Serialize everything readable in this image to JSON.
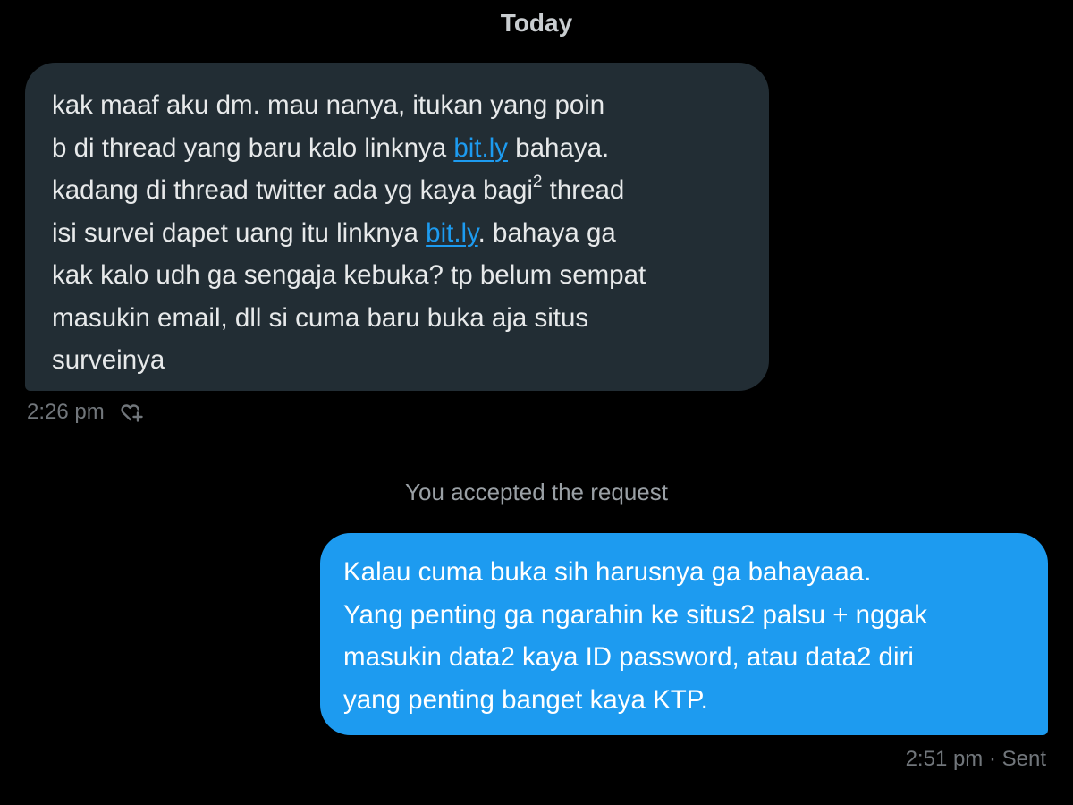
{
  "conversation": {
    "day_label": "Today",
    "incoming_message": {
      "lines": [
        [
          {
            "text": "kak maaf aku dm. mau nanya, itukan yang poin"
          }
        ],
        [
          {
            "text": "b di thread yang baru kalo linknya "
          },
          {
            "text": "bit.ly",
            "link": true
          },
          {
            "text": " bahaya."
          }
        ],
        [
          {
            "text": "kadang di thread twitter ada yg kaya bagi"
          },
          {
            "text": "2",
            "sup": true
          },
          {
            "text": " thread"
          }
        ],
        [
          {
            "text": "isi survei dapet uang itu linknya "
          },
          {
            "text": "bit.ly",
            "link": true
          },
          {
            "text": ". bahaya ga"
          }
        ],
        [
          {
            "text": "kak kalo udh ga sengaja kebuka? tp belum sempat"
          }
        ],
        [
          {
            "text": "masukin email, dll si cuma baru buka aja situs"
          }
        ],
        [
          {
            "text": "surveinya"
          }
        ]
      ],
      "timestamp": "2:26 pm",
      "react_icon": "heart-plus-icon"
    },
    "system_note": "You accepted the request",
    "outgoing_message": {
      "lines": [
        "Kalau cuma buka sih harusnya ga bahayaaa.",
        "Yang penting ga ngarahin ke situs2 palsu + nggak",
        "masukin data2 kaya ID password, atau data2 diri",
        "yang penting banget kaya KTP."
      ],
      "timestamp": "2:51 pm · Sent"
    }
  },
  "colors": {
    "background": "#000000",
    "incoming_bubble": "#222d34",
    "outgoing_bubble": "#1d9bf0",
    "link": "#1d9bf0",
    "meta_text": "#71767b"
  }
}
